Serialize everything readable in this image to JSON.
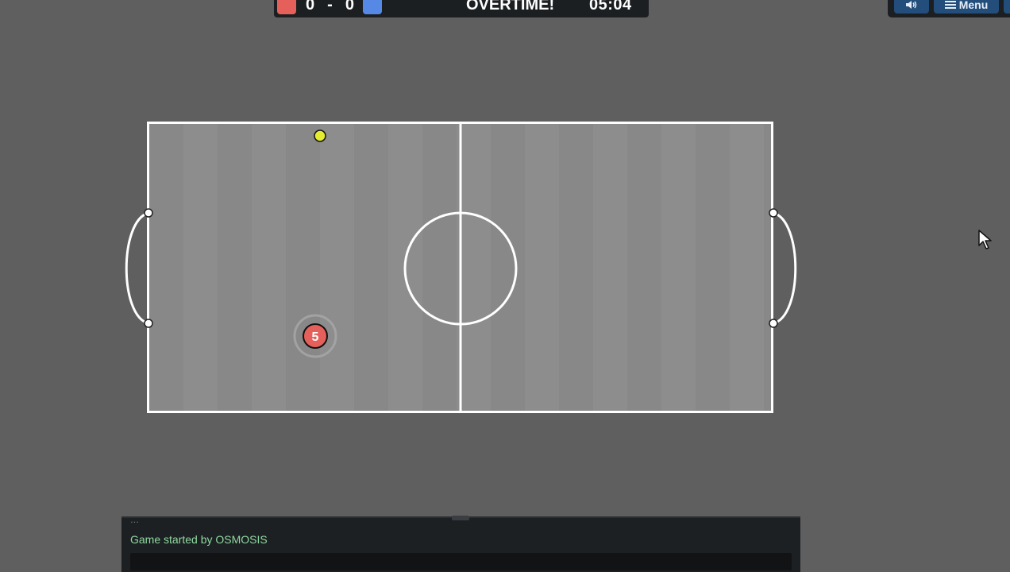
{
  "scoreboard": {
    "red_score": "0",
    "separator": "-",
    "blue_score": "0",
    "status": "OVERTIME!",
    "timer": "05:04",
    "colors": {
      "red": "#e5605a",
      "blue": "#5689e5"
    }
  },
  "controls": {
    "sound_icon": "speaker-icon",
    "menu_icon": "hamburger-icon",
    "menu_label": "Menu"
  },
  "field": {
    "line_color": "#ffffff",
    "ball_color": "#e3ec2f",
    "player": {
      "team": "red",
      "number": "5",
      "color": "#e5605a"
    }
  },
  "chat": {
    "faded_line": "...",
    "message": "Game started by OSMOSIS",
    "input_value": ""
  }
}
